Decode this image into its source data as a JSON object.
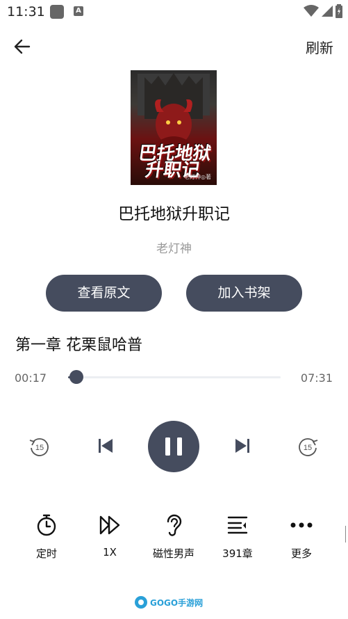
{
  "status_bar": {
    "time": "11:31",
    "a_label": "A"
  },
  "header": {
    "refresh_label": "刷新"
  },
  "book": {
    "cover_title": "巴托地狱升职记",
    "cover_author": "老灯神◎著",
    "title": "巴托地狱升职记",
    "author": "老灯神"
  },
  "actions": {
    "view_original": "查看原文",
    "add_to_shelf": "加入书架"
  },
  "chapter": {
    "title": "第一章 花栗鼠哈普"
  },
  "player": {
    "current_time": "00:17",
    "total_time": "07:31",
    "progress": 0.038,
    "rewind_seconds": "15",
    "forward_seconds": "15"
  },
  "bottom_bar": {
    "timer": "定时",
    "speed": "1X",
    "voice": "磁性男声",
    "chapters": "391章",
    "more": "更多"
  },
  "watermark": {
    "text": "GOGO手游网"
  },
  "colors": {
    "accent": "#454c5e",
    "muted": "#999999"
  }
}
